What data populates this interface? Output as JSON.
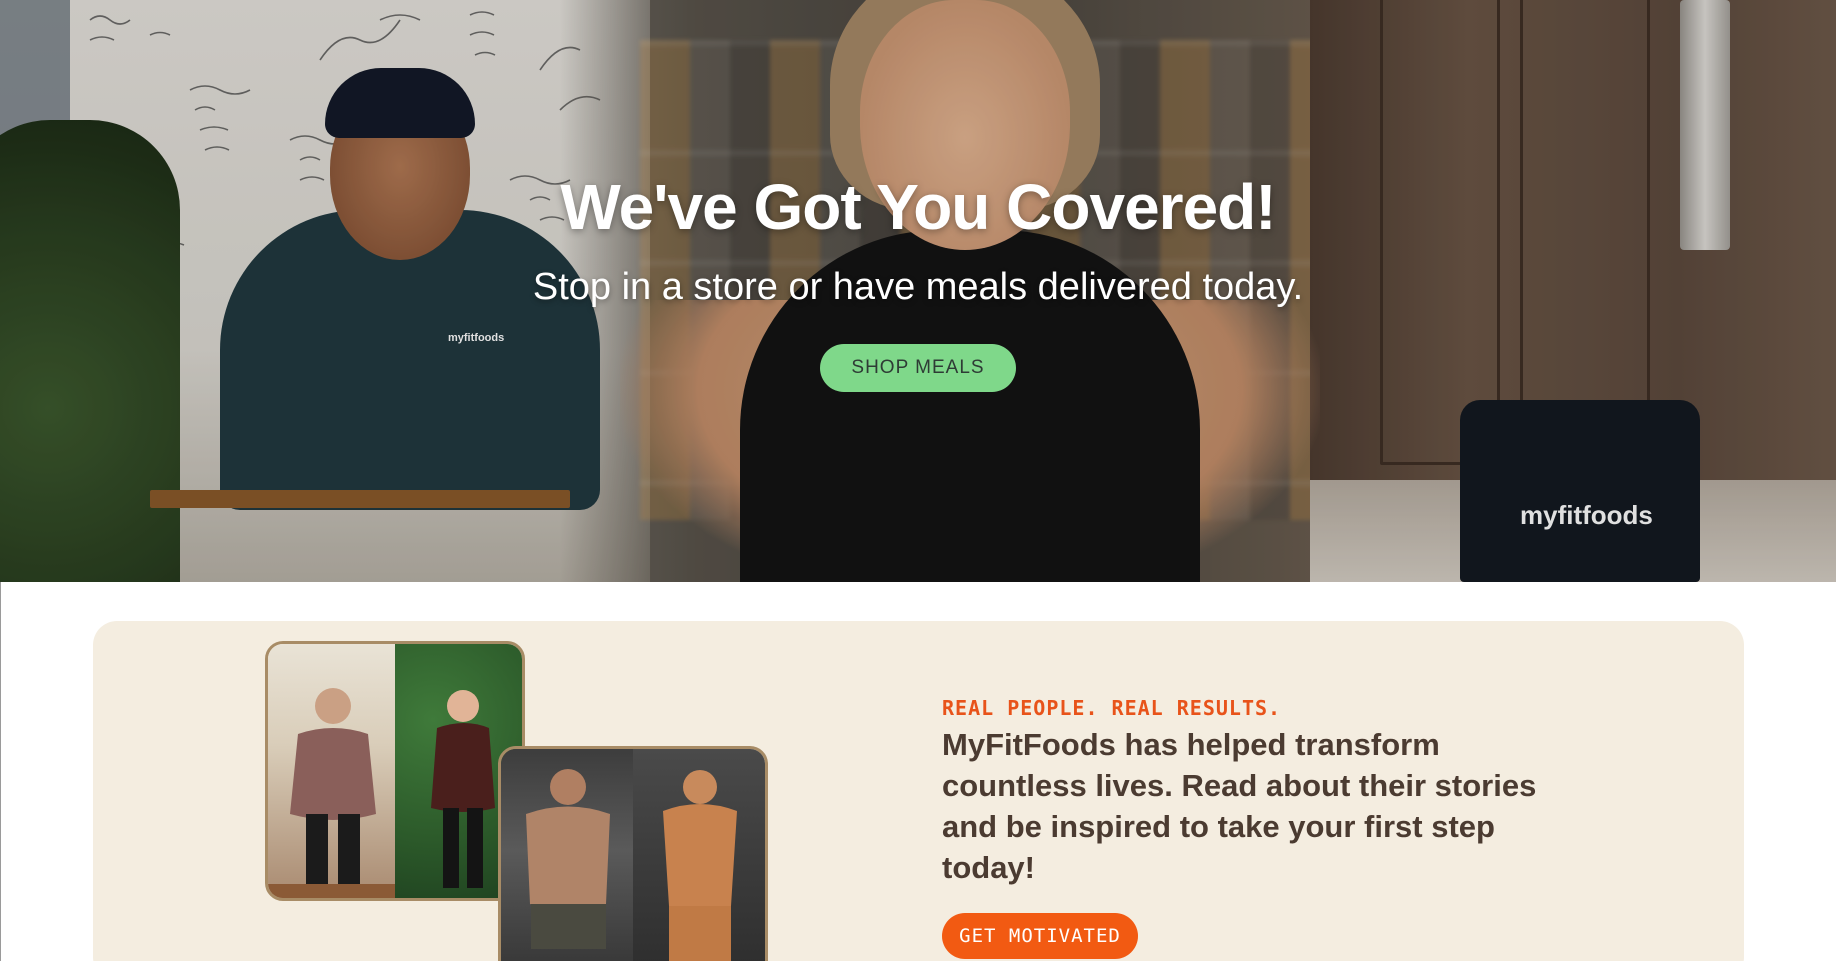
{
  "hero": {
    "title": "We've Got You Covered!",
    "subtitle": "Stop in a store or have meals delivered today.",
    "cta_label": "SHOP MEALS",
    "shirt_logo": "myfitfoods",
    "bag_logo": "myfitfoods",
    "cta_color": "#7fd88a"
  },
  "results": {
    "eyebrow": "REAL PEOPLE. REAL RESULTS.",
    "body": "MyFitFoods has helped transform countless lives. Read about their stories and be inspired to take your first step today!",
    "cta_label": "GET MOTIVATED",
    "eyebrow_color": "#e8531a",
    "cta_color": "#f25a12",
    "background_color": "#f4ede0"
  }
}
